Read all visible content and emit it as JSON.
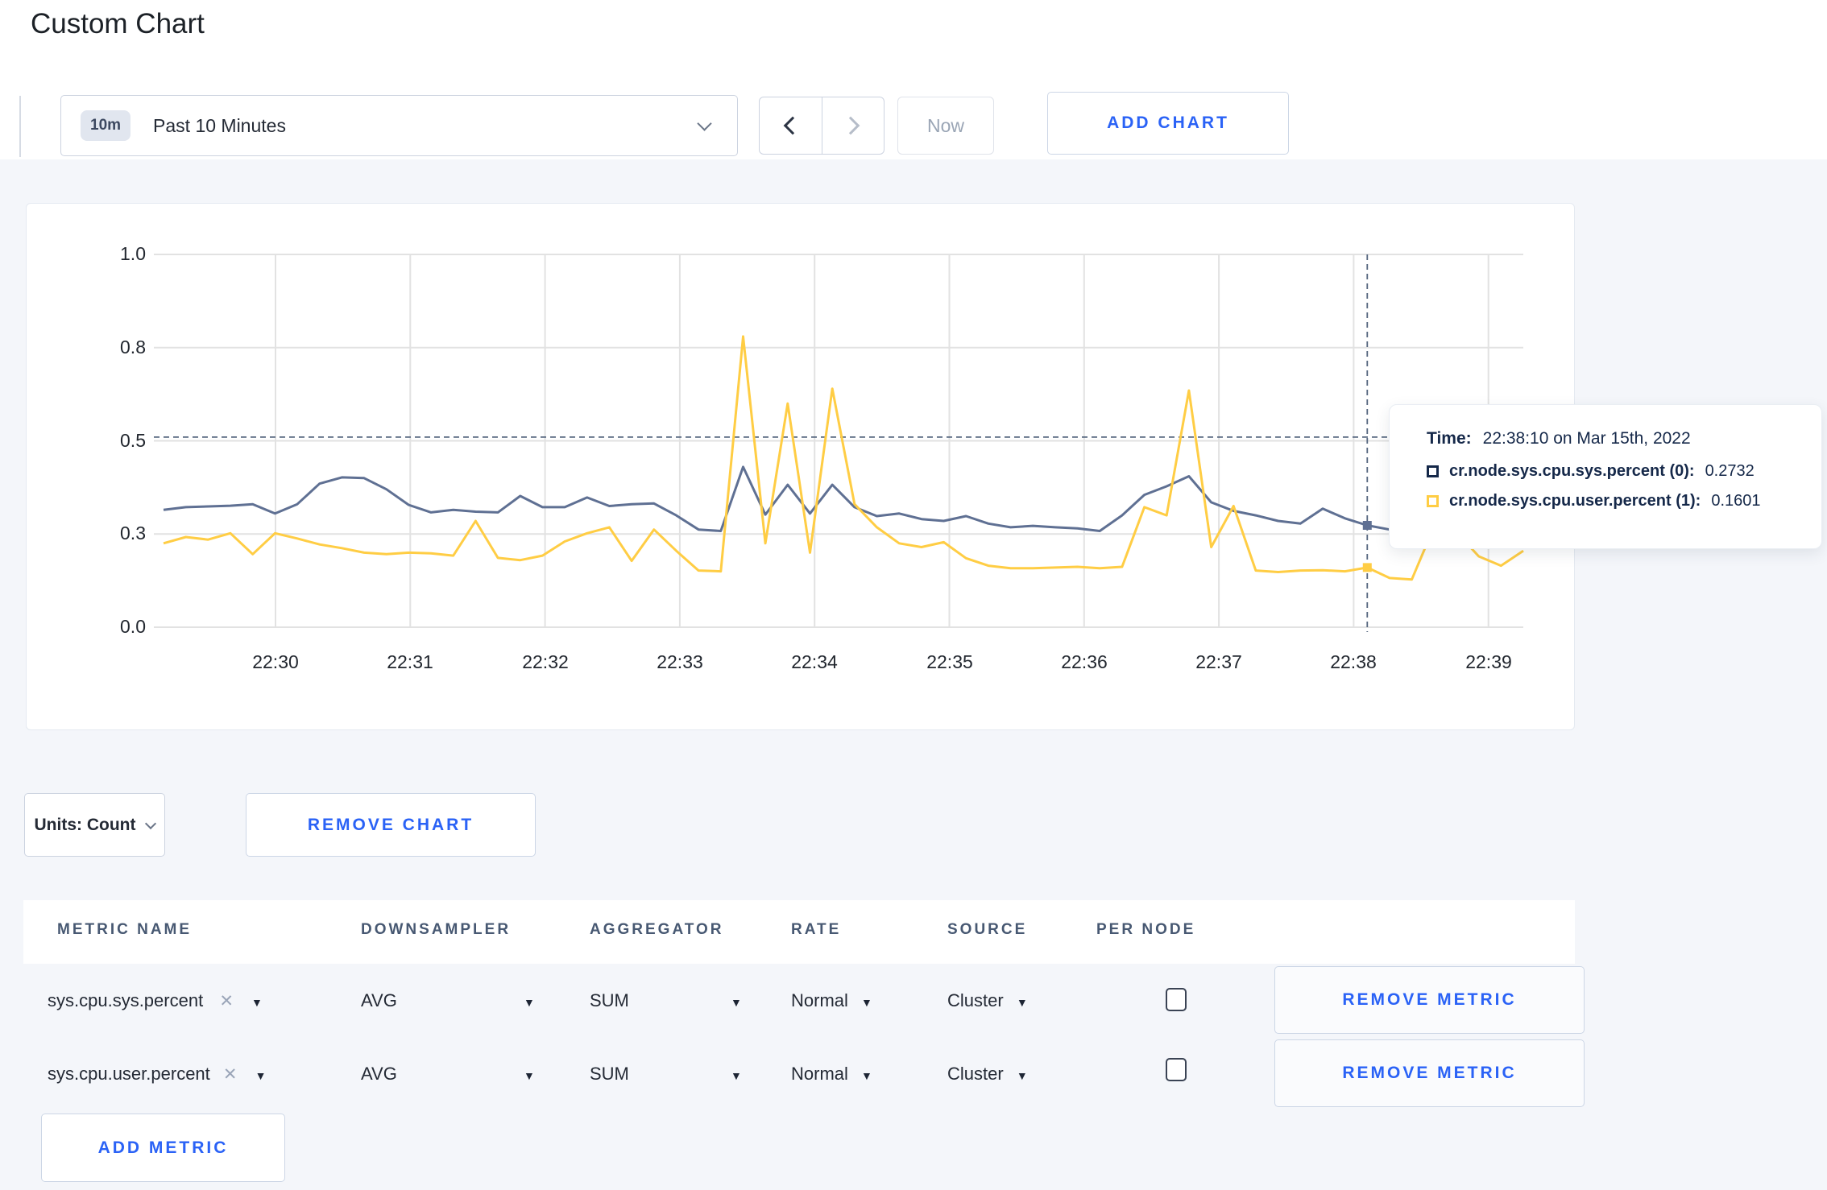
{
  "page": {
    "title": "Custom Chart"
  },
  "toolbar": {
    "range_badge": "10m",
    "range_label": "Past 10 Minutes",
    "now_label": "Now",
    "add_chart_label": "ADD CHART"
  },
  "chart_data": {
    "type": "line",
    "title": "",
    "xlabel": "",
    "ylabel": "",
    "ylim": [
      0,
      1
    ],
    "grid": true,
    "x_ticks": [
      "22:30",
      "22:31",
      "22:32",
      "22:33",
      "22:34",
      "22:35",
      "22:36",
      "22:37",
      "22:38",
      "22:39"
    ],
    "y_ticks": [
      {
        "label": "0.0",
        "value": 0
      },
      {
        "label": "0.3",
        "value": 0.25
      },
      {
        "label": "0.5",
        "value": 0.5
      },
      {
        "label": "0.8",
        "value": 0.75
      },
      {
        "label": "1.0",
        "value": 1.0
      }
    ],
    "x_start": "22:29:10",
    "x_end": "22:39:20",
    "x_step_seconds": 10,
    "crosshair": {
      "index": 54,
      "time": "22:38:10",
      "hover_y_value": 0.51
    },
    "series": [
      {
        "name": "cr.node.sys.cpu.sys.percent",
        "color": "#5f7093",
        "marker_value": 0.2732,
        "values": [
          0.315,
          0.322,
          0.324,
          0.326,
          0.33,
          0.305,
          0.33,
          0.385,
          0.402,
          0.4,
          0.37,
          0.328,
          0.308,
          0.315,
          0.31,
          0.308,
          0.352,
          0.322,
          0.322,
          0.348,
          0.325,
          0.33,
          0.332,
          0.3,
          0.262,
          0.258,
          0.43,
          0.302,
          0.382,
          0.305,
          0.382,
          0.322,
          0.298,
          0.305,
          0.29,
          0.285,
          0.298,
          0.278,
          0.268,
          0.272,
          0.268,
          0.265,
          0.258,
          0.3,
          0.355,
          0.378,
          0.405,
          0.335,
          0.312,
          0.3,
          0.285,
          0.278,
          0.318,
          0.292,
          0.2732,
          0.262,
          0.265,
          0.272,
          0.278,
          0.285,
          0.29,
          0.288
        ]
      },
      {
        "name": "cr.node.sys.cpu.user.percent",
        "color": "#ffcd44",
        "marker_value": 0.1601,
        "values": [
          0.225,
          0.242,
          0.235,
          0.252,
          0.196,
          0.252,
          0.238,
          0.222,
          0.212,
          0.2,
          0.196,
          0.2,
          0.198,
          0.192,
          0.285,
          0.186,
          0.18,
          0.192,
          0.23,
          0.252,
          0.268,
          0.178,
          0.262,
          0.205,
          0.152,
          0.15,
          0.78,
          0.225,
          0.6,
          0.2,
          0.64,
          0.33,
          0.268,
          0.225,
          0.215,
          0.228,
          0.185,
          0.165,
          0.158,
          0.158,
          0.16,
          0.162,
          0.158,
          0.162,
          0.322,
          0.3,
          0.635,
          0.215,
          0.325,
          0.152,
          0.148,
          0.152,
          0.153,
          0.15,
          0.1601,
          0.132,
          0.128,
          0.27,
          0.255,
          0.19,
          0.165,
          0.205
        ]
      }
    ],
    "legend_position": "tooltip"
  },
  "tooltip": {
    "time_label": "Time:",
    "time_value": "22:38:10 on Mar 15th, 2022",
    "series": [
      {
        "label": "cr.node.sys.cpu.sys.percent (0):",
        "value": "0.2732",
        "color": "#152849"
      },
      {
        "label": "cr.node.sys.cpu.user.percent (1):",
        "value": "0.1601",
        "color": "#ffcd44"
      }
    ]
  },
  "controls": {
    "units_label": "Units: Count",
    "remove_chart_label": "REMOVE CHART",
    "add_metric_label": "ADD METRIC"
  },
  "metrics_table": {
    "headers": [
      "METRIC NAME",
      "DOWNSAMPLER",
      "AGGREGATOR",
      "RATE",
      "SOURCE",
      "PER NODE"
    ],
    "remove_metric_label": "REMOVE METRIC",
    "rows": [
      {
        "name": "sys.cpu.sys.percent",
        "downsampler": "AVG",
        "aggregator": "SUM",
        "rate": "Normal",
        "source": "Cluster",
        "per_node_checked": false
      },
      {
        "name": "sys.cpu.user.percent",
        "downsampler": "AVG",
        "aggregator": "SUM",
        "rate": "Normal",
        "source": "Cluster",
        "per_node_checked": false
      }
    ]
  },
  "colors": {
    "accent_blue": "#2a62f6",
    "navy_text": "#152849",
    "grid": "#e2e2e2",
    "crosshair": "#54657e",
    "page_bg": "#f4f6fa"
  }
}
